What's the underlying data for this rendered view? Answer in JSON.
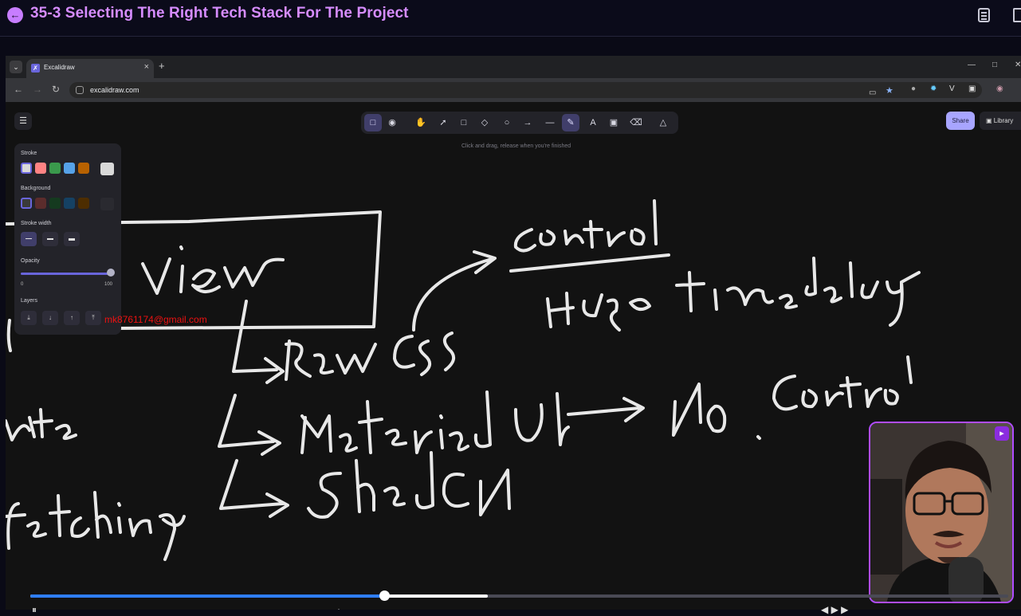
{
  "player": {
    "lesson_title": "35-3 Selecting The Right Tech Stack For The Project",
    "icons": [
      "back-arrow-icon",
      "notes-icon",
      "bookmark-icon"
    ],
    "accent_color": "#d68cff",
    "progress": {
      "played_fraction": 0.362,
      "buffered_fraction": 0.468,
      "played_color": "#2f7ef5"
    }
  },
  "browser": {
    "tab_title": "Excalidraw",
    "tab_close": "×",
    "new_tab": "+",
    "url": "excalidraw.com"
  },
  "excalidraw": {
    "hint": "Click and drag, release when you're finished",
    "share_label": "Share",
    "library_label": "Library",
    "panel": {
      "stroke_label": "Stroke",
      "background_label": "Background",
      "stroke_width_label": "Stroke width",
      "opacity_label": "Opacity",
      "opacity_min": "0",
      "opacity_max": "100",
      "layers_label": "Layers",
      "stroke_colors": [
        "#d9d9d9",
        "#ff8383",
        "#3a994c",
        "#56a2e8",
        "#b76100"
      ],
      "background_colors": [
        "#3a3a3a",
        "#5b2c2c",
        "#153a1f",
        "#154163",
        "#4d2d00"
      ]
    },
    "watermark": "mk8761174@gmail.com"
  },
  "handwriting": {
    "note": "Whiteboard content is freehand drawing (words: View, control, Huge time delay, Raw CSS, Material UI, No. control, ShadCN, fetching)"
  }
}
